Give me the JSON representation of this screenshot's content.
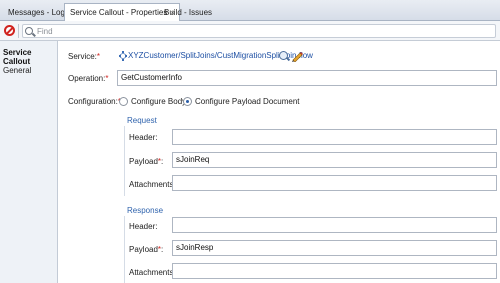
{
  "tabs": [
    {
      "label": "Messages - Log"
    },
    {
      "label": "Service Callout - Properties",
      "close": "×"
    },
    {
      "label": "Build - Issues"
    }
  ],
  "toolbar": {
    "find_placeholder": "Find"
  },
  "nav": {
    "items": [
      {
        "label": "Service Callout"
      },
      {
        "label": "General"
      }
    ]
  },
  "form": {
    "service_label": "Service:",
    "service_value": "XYZCustomer/SplitJoins/CustMigrationSplitJoin.flow",
    "operation_label": "Operation:",
    "operation_value": "GetCustomerInfo",
    "configuration_label": "Configuration:",
    "config_options": [
      {
        "label": "Configure Body",
        "selected": false
      },
      {
        "label": "Configure Payload Document",
        "selected": true
      }
    ],
    "required_mark": "*",
    "request": {
      "title": "Request",
      "header_label": "Header:",
      "header_value": "",
      "payload_label": "Payload",
      "payload_value": "sJoinReq",
      "attachments_label": "Attachments:",
      "attachments_value": ""
    },
    "response": {
      "title": "Response",
      "header_label": "Header:",
      "header_value": "",
      "payload_label": "Payload",
      "payload_value": "sJoinResp",
      "attachments_label": "Attachments:",
      "attachments_value": ""
    }
  }
}
